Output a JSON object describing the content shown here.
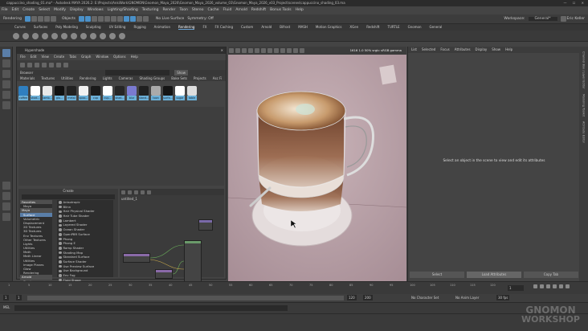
{
  "window": {
    "title": "cappuccino_shading_01.ma* - Autodesk MAYA 2026.2: E:\\Projects\\AnkiWork\\GNOMON\\Gnomon_Maya_2026\\Gnomon_Maya_2026_volume_03\\Gnomon_Maya_2026_v03_Project\\scenes\\cappuccino_shading_03.ma",
    "controls": "— ☐ ✕"
  },
  "menubar": [
    "File",
    "Edit",
    "Create",
    "Select",
    "Modify",
    "Display",
    "Windows",
    "Lighting/Shading",
    "Texturing",
    "Render",
    "Toon",
    "Stereo",
    "Cache",
    "Fluid",
    "Arnold",
    "Redshift",
    "Bonus Tools",
    "Help"
  ],
  "status": {
    "mode": "Rendering",
    "objects": "Objects",
    "surface": "No Live Surface",
    "symmetry": "Symmetry: Off",
    "workspace_label": "Workspace:",
    "workspace": "General*",
    "user": "Eric Keller"
  },
  "shelf_tabs": [
    "Curves",
    "Surfaces",
    "Poly Modeling",
    "Sculpting",
    "UV Editing",
    "Rigging",
    "Animation",
    "Rendering",
    "FX",
    "FX Caching",
    "Custom",
    "Arnold",
    "Bifrost",
    "MASH",
    "Motion Graphics",
    "XGen",
    "Redshift",
    "TURTLE",
    "Gnomon",
    "General"
  ],
  "active_shelf": "Rendering",
  "hypershade": {
    "title": "Hypershade",
    "menu": [
      "File",
      "Edit",
      "View",
      "Create",
      "Tabs",
      "Graph",
      "Window",
      "Options",
      "Help"
    ],
    "browser_label": "Browser",
    "search_placeholder": "",
    "show_label": "Show",
    "browser_tabs": [
      "Materials",
      "Textures",
      "Utilities",
      "Rendering",
      "Lights",
      "Cameras",
      "Shading Groups",
      "Bake Sets",
      "Projects",
      "Asc Fi"
    ],
    "swatches": [
      {
        "name": "coffee",
        "color": "#2f7fc0"
      },
      {
        "name": "shad...",
        "color": "#ffffff"
      },
      {
        "name": "lamb...",
        "color": "#e8e8e8"
      },
      {
        "name": "gla...",
        "color": "#111111"
      },
      {
        "name": "metal",
        "color": "#222222"
      },
      {
        "name": "spoo...",
        "color": "#f2f2f2"
      },
      {
        "name": "cup",
        "color": "#1a1a1a"
      },
      {
        "name": "cup...",
        "color": "#ffffff"
      },
      {
        "name": "shad...",
        "color": "#262626"
      },
      {
        "name": "blur",
        "color": "#7a7ad0"
      },
      {
        "name": "stand...",
        "color": "#202020"
      },
      {
        "name": "toon",
        "color": "#aaaaaa"
      },
      {
        "name": "surfa...",
        "color": "#151515"
      },
      {
        "name": "sugar",
        "color": "#ffffff"
      },
      {
        "name": "table",
        "color": "#dddddd"
      }
    ],
    "create_label": "Create",
    "create_tree": [
      {
        "label": "Favorites",
        "kind": "h"
      },
      {
        "label": "Maya",
        "kind": "i"
      },
      {
        "label": "Maya",
        "kind": "h"
      },
      {
        "label": "Surface",
        "kind": "sel"
      },
      {
        "label": "Volumetric",
        "kind": "i"
      },
      {
        "label": "Displacement",
        "kind": "i"
      },
      {
        "label": "2D Textures",
        "kind": "i"
      },
      {
        "label": "3D Textures",
        "kind": "i"
      },
      {
        "label": "Env Textures",
        "kind": "i"
      },
      {
        "label": "Other Textures",
        "kind": "i"
      },
      {
        "label": "Lights",
        "kind": "i"
      },
      {
        "label": "Utilities",
        "kind": "i"
      },
      {
        "label": "Math",
        "kind": "i"
      },
      {
        "label": "Math Linear",
        "kind": "i"
      },
      {
        "label": "Utilities",
        "kind": "i"
      },
      {
        "label": "Image Planes",
        "kind": "i"
      },
      {
        "label": "Glow",
        "kind": "i"
      },
      {
        "label": "Rendering",
        "kind": "i"
      },
      {
        "label": "Arnold",
        "kind": "h"
      },
      {
        "label": "Shader",
        "kind": "i"
      },
      {
        "label": "Texture",
        "kind": "i"
      }
    ],
    "shader_list": [
      "Anisotropic",
      "Blinn",
      "Hair Physical Shader",
      "Hair Tube Shader",
      "Lambert",
      "Layered Shader",
      "Ocean Shader",
      "OpenPBR Surface",
      "Phong",
      "Phong E",
      "Ramp Shader",
      "Shading Map",
      "Standard Surface",
      "Surface Shader",
      "Use Preview Surface",
      "Use Background",
      "Env Fog",
      "Fluid Shape"
    ],
    "graph_tab": "untitled_1"
  },
  "viewport": {
    "readout": "1616 1.0 50% srgb: sRGB gamma"
  },
  "attribute_editor": {
    "menu": [
      "List",
      "Selected",
      "Focus",
      "Attributes",
      "Display",
      "Show",
      "Help"
    ],
    "message": "Select an object in the scene to view and edit its attributes",
    "buttons": [
      "Select",
      "Load Attributes",
      "Copy Tab"
    ]
  },
  "right_strip": [
    "Channel Box / Layer Editor",
    "Modeling Toolkit",
    "Attribute Editor"
  ],
  "timeline": {
    "ticks": [
      "1",
      "5",
      "10",
      "15",
      "20",
      "25",
      "30",
      "35",
      "40",
      "45",
      "50",
      "55",
      "60",
      "65",
      "70",
      "75",
      "80",
      "85",
      "90",
      "95",
      "100",
      "105",
      "110",
      "115",
      "120"
    ],
    "current_frame": "1"
  },
  "range": {
    "start": "1",
    "inner_start": "1",
    "inner_end": "120",
    "end": "200",
    "character_set": "No Character Set",
    "anim_layer": "No Anim Layer",
    "fps": "30 fps"
  },
  "command_line": {
    "label": "MEL"
  },
  "watermark": {
    "line1": "GNOMON",
    "line2": "WORKSHOP"
  }
}
